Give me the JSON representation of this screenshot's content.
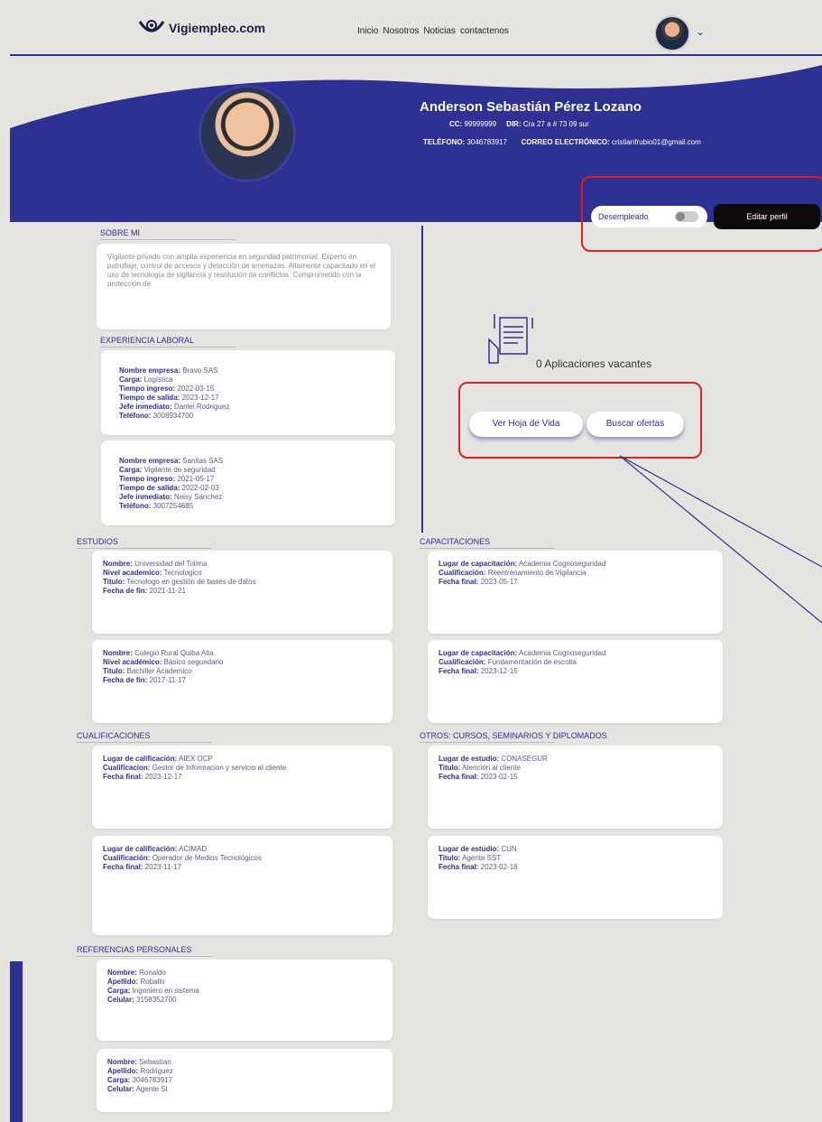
{
  "header": {
    "logo_text": "Vigiempleo.com",
    "nav": [
      "Inicio",
      "Nosotros",
      "Noticias",
      "contactenos"
    ]
  },
  "profile": {
    "name": "Anderson Sebastián Pérez Lozano",
    "cc_label": "CC:",
    "cc_value": "99999999",
    "dir_label": "DIR:",
    "dir_value": "Cra 27 a # 73 09 sur",
    "tel_label": "TELÉFONO:",
    "tel_value": "3046783917",
    "email_label": "CORREO ELECTRÓNICO:",
    "email_value": "cristianfrubio01@gmail.com",
    "status_label": "Desempleado",
    "edit_label": "Editar perfil"
  },
  "about": {
    "title": "SOBRE MI",
    "text": "Vigilante privado con amplia experiencia en seguridad patrimonial. Experto en patrullaje, control de accesos y detección de amenazas. Altamente capacitado en el uso de tecnología de vigilancia y resolución de conflictos. Comprometido con la protección de"
  },
  "experience": {
    "title": "EXPERIENCIA LABORAL",
    "items": [
      {
        "l1": "Nombre empresa:",
        "v1": "Bravo SAS",
        "l2": "Carga:",
        "v2": "Logística",
        "l3": "Tiempo ingreso:",
        "v3": "2022-03-15",
        "l4": "Tiempo de salida:",
        "v4": "2023-12-17",
        "l5": "Jefe inmediato:",
        "v5": "Daniel Rodriguez",
        "l6": "Teléfono:",
        "v6": "3008934700"
      },
      {
        "l1": "Nombre empresa:",
        "v1": "Sanitas SAS",
        "l2": "Carga:",
        "v2": "Vigilante de seguridad",
        "l3": "Tiempo ingreso:",
        "v3": "2021-05-17",
        "l4": "Tiempo de salida:",
        "v4": "2022-02-03",
        "l5": "Jefe inmediato:",
        "v5": "Neisy Sánchez",
        "l6": "Teléfono:",
        "v6": "3007254685"
      }
    ]
  },
  "applications": {
    "text": "0 Aplicaciones vacantes",
    "cv_button": "Ver Hoja de Vida",
    "offers_button": "Buscar ofertas"
  },
  "studies": {
    "title": "ESTUDIOS",
    "items": [
      {
        "l1": "Nombre:",
        "v1": "Universidad del Tolima",
        "l2": "Nivel academico:",
        "v2": "Tecnologico",
        "l3": "Titulo:",
        "v3": "Tecnologo en gestión de bases de datos",
        "l4": "Fecha de fin:",
        "v4": "2021-11-21"
      },
      {
        "l1": "Nombre:",
        "v1": "Colegio Rural Quiba Alta",
        "l2": "Nivel académico:",
        "v2": "Básico segundario",
        "l3": "Titulo:",
        "v3": "Bachiller Academico",
        "l4": "Fecha de fin:",
        "v4": "2017-11-17"
      }
    ]
  },
  "trainings": {
    "title": "CAPACITACIONES",
    "items": [
      {
        "l1": "Lugar de capacitación:",
        "v1": "Academia Cognoseguridad",
        "l2": "Cualificación:",
        "v2": "Reentrenamiento de Vigilancia",
        "l3": "Fecha final:",
        "v3": "2023-05-17"
      },
      {
        "l1": "Lugar de capacitación:",
        "v1": "Academia Cognoseguridad",
        "l2": "Cualificación:",
        "v2": "Fundamentación de escolta",
        "l3": "Fecha final:",
        "v3": "2023-12-15"
      }
    ]
  },
  "qualifications": {
    "title": "CUALIFICACIONES",
    "items": [
      {
        "l1": "Lugar de calificación:",
        "v1": "AIEX OCP",
        "l2": "Cualificacion:",
        "v2": "Gestor de Informacion y servicio al cliente",
        "l3": "Fecha final:",
        "v3": "2023-12-17"
      },
      {
        "l1": "Lugar de calificación:",
        "v1": "ACIMAD",
        "l2": "Cualificación:",
        "v2": "Operador de Medios Tecnológicos",
        "l3": "Fecha final:",
        "v3": "2023-11-17"
      }
    ]
  },
  "other_courses": {
    "title": "OTROS: CURSOS, SEMINARIOS Y DIPLOMADOS",
    "items": [
      {
        "l1": "Lugar de estudio:",
        "v1": "CONASEGUR",
        "l2": "Titulo:",
        "v2": "Atención al cliente",
        "l3": "Fecha final:",
        "v3": "2023-02-15"
      },
      {
        "l1": "Lugar de estudio:",
        "v1": "CUN",
        "l2": "Titulo:",
        "v2": "Agente SST",
        "l3": "Fecha final:",
        "v3": "2023-02-18"
      }
    ]
  },
  "references": {
    "title": "REFERENCIAS PERSONALES",
    "items": [
      {
        "l1": "Nombre:",
        "v1": "Ronaldo",
        "l2": "Apellido:",
        "v2": "Roballo",
        "l3": "Carga:",
        "v3": "Ingeniero en sistema",
        "l4": "Celular:",
        "v4": "3158352700"
      },
      {
        "l1": "Nombre:",
        "v1": "Sebastian",
        "l2": "Apellido:",
        "v2": "Rodriguez",
        "l3": "Carga:",
        "v3": "3046783917",
        "l4": "Celular:",
        "v4": "Agente SI"
      }
    ]
  },
  "colors": {
    "primary": "#2e3192",
    "highlight": "#e02020",
    "background": "#e6e4e1"
  }
}
